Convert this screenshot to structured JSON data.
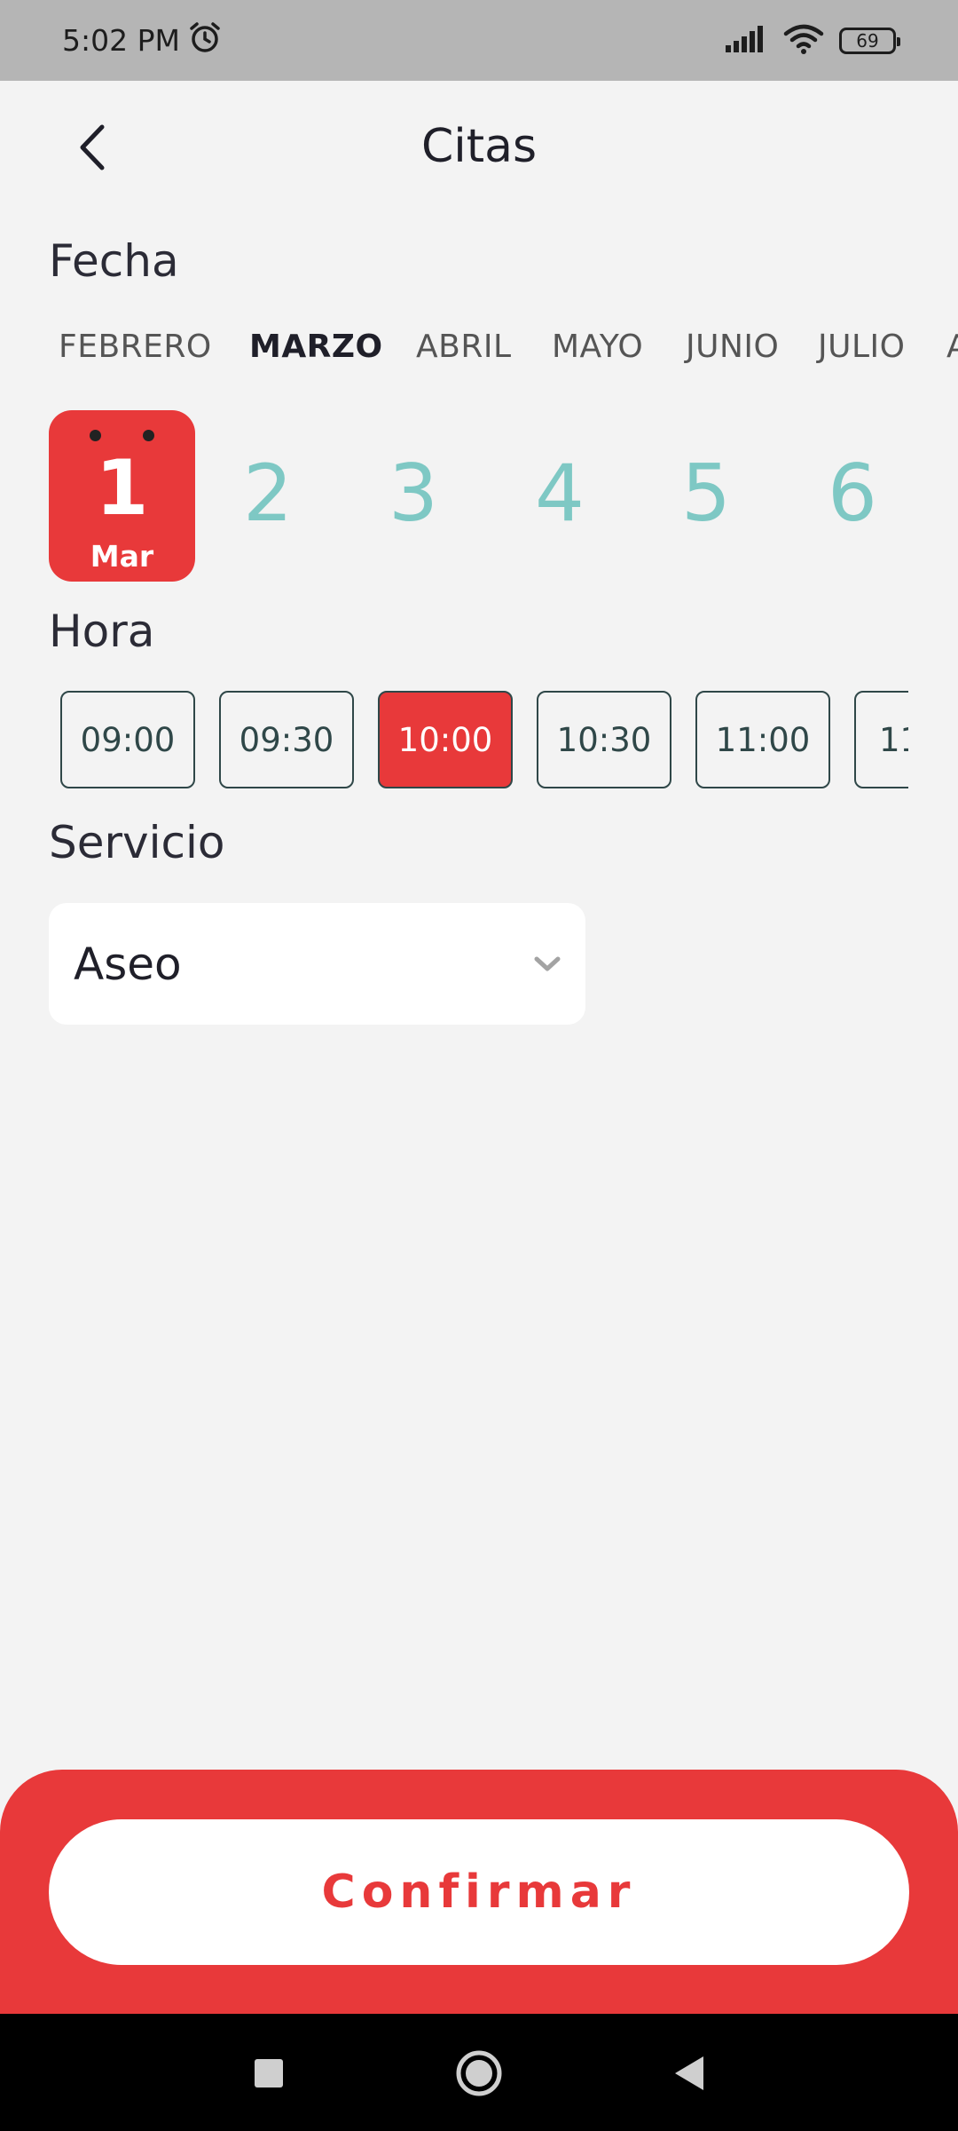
{
  "status_bar": {
    "time": "5:02 PM",
    "battery": "69",
    "icons": [
      "alarm-icon",
      "signal-icon",
      "wifi-icon",
      "battery-icon"
    ]
  },
  "header": {
    "title": "Citas",
    "back_icon": "chevron-left-icon"
  },
  "date_section": {
    "label": "Fecha",
    "months": [
      "FEBRERO",
      "MARZO",
      "ABRIL",
      "MAYO",
      "JUNIO",
      "JULIO",
      "A"
    ],
    "active_month": "MARZO",
    "selected_day": {
      "number": "1",
      "month_abbr": "Mar"
    },
    "days": [
      "2",
      "3",
      "4",
      "5",
      "6"
    ]
  },
  "time_section": {
    "label": "Hora",
    "slots": [
      "09:00",
      "09:30",
      "10:00",
      "10:30",
      "11:00",
      "11"
    ],
    "selected_slot": "10:00"
  },
  "service_section": {
    "label": "Servicio",
    "selected_value": "Aseo",
    "dropdown_icon": "chevron-down-icon"
  },
  "footer": {
    "confirm_label": "Confirmar"
  },
  "colors": {
    "accent": "#e8393a",
    "day_number": "#7ec8c4",
    "slot_border": "#2f4748",
    "background": "#f3f3f3"
  }
}
